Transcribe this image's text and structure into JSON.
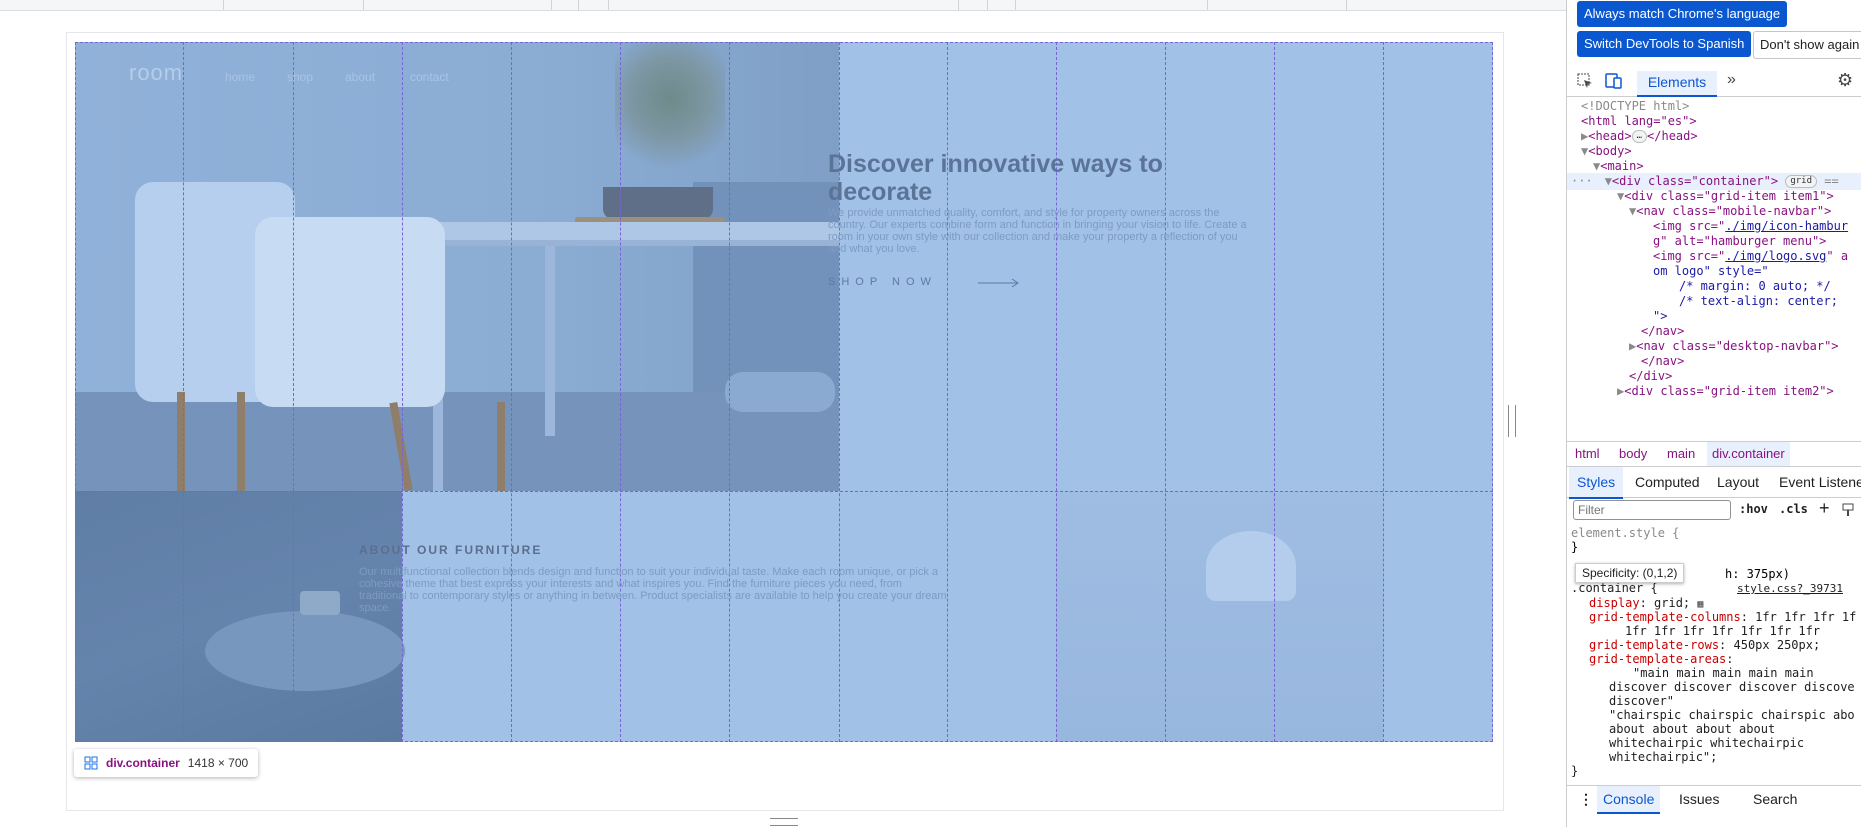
{
  "page": {
    "logo": "room",
    "nav": [
      "home",
      "shop",
      "about",
      "contact"
    ],
    "heading": "Discover innovative ways to decorate",
    "description": "We provide unmatched quality, comfort, and style for property owners across the country. Our experts combine form and function in bringing your vision to life. Create a room in your own style with our collection and make your property a reflection of you and what you love.",
    "shop_now": "SHOP NOW",
    "about_title": "ABOUT OUR FURNITURE",
    "about_desc": "Our multifunctional collection blends design and function to suit your individual taste. Make each room unique, or pick a cohesive theme that best express your interests and what inspires you. Find the furniture pieces you need, from traditional to contemporary styles or anything in between. Product specialists are available to help you create your dream space."
  },
  "overlay": {
    "selector": "div.container",
    "dimensions": "1418 × 700"
  },
  "devtools": {
    "lang_banner": {
      "match_button": "Always match Chrome's language",
      "switch_button": "Switch DevTools to Spanish",
      "dont_show": "Don't show again"
    },
    "tabs": {
      "elements": "Elements"
    },
    "dom": {
      "doctype": "<!DOCTYPE html>",
      "html_open": "<html lang=\"es\">",
      "head": "<head>",
      "head_close": "</head>",
      "body_open": "<body>",
      "main_open": "<main>",
      "container_open": "<div class=\"container\">",
      "grid_badge": "grid",
      "eq0": "==",
      "item1_open": "<div class=\"grid-item item1\">",
      "mobile_nav_open": "<nav class=\"mobile-navbar\">",
      "img1_a": "<img src=\"",
      "img1_src": "./img/icon-hambur",
      "img1_b": "g\" alt=\"hamburger menu\">",
      "img2_a": "<img src=\"",
      "img2_src": "./img/logo.svg",
      "img2_b": "\" a",
      "img2_c": "om logo\" style=\"",
      "comment1": "/* margin: 0 auto; */",
      "comment2": "/* text-align: center; ",
      "close_attr": "\">",
      "nav_close": "</nav>",
      "desktop_nav": "<nav class=\"desktop-navbar\">",
      "nav_close2": "</nav>",
      "div_close": "</div>",
      "item2": "<div class=\"grid-item item2\">"
    },
    "breadcrumbs": [
      "html",
      "body",
      "main",
      "div.container"
    ],
    "subtabs": [
      "Styles",
      "Computed",
      "Layout",
      "Event Listeners"
    ],
    "filter_placeholder": "Filter",
    "hov": ":hov",
    "cls": ".cls",
    "styles": {
      "element_style": "element.style {",
      "brace_close": "}",
      "tooltip": "Specificity: (0,1,2)",
      "media_tail": "h: 375px)",
      "rule_selector": ".container {",
      "source": "style.css?_39731",
      "decl_display_prop": "display",
      "decl_display_val": "grid;",
      "decl_cols_prop": "grid-template-columns",
      "decl_cols_val": "1fr 1fr 1fr 1f",
      "decl_cols_val2": "1fr 1fr 1fr 1fr 1fr 1fr 1fr",
      "decl_rows_prop": "grid-template-rows",
      "decl_rows_val": "450px 250px;",
      "decl_areas_prop": "grid-template-areas",
      "areas_1": "\"main main main main main",
      "areas_2": "discover discover discover discove",
      "areas_3": "discover\"",
      "areas_4": "\"chairspic chairspic chairspic abo",
      "areas_5": "about about about about",
      "areas_6": "whitechairpic whitechairpic",
      "areas_7": "whitechairpic\";",
      "final_brace": "}"
    },
    "drawer_tabs": [
      "Console",
      "Issues",
      "Search"
    ]
  }
}
